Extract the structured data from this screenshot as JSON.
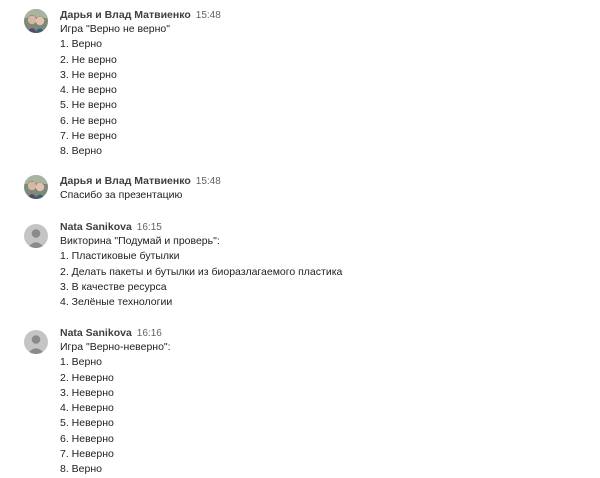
{
  "messages": [
    {
      "sender": "Дарья и Влад Матвиенко",
      "time": "15:48",
      "avatar": "photo-avatar-icon",
      "lines": [
        "Игра \"Верно не верно\"",
        "1. Верно",
        "2. Не верно",
        "3. Не верно",
        "4. Не верно",
        "5. Не верно",
        "6. Не верно",
        "7. Не верно",
        "8. Верно"
      ]
    },
    {
      "sender": "Дарья и Влад Матвиенко",
      "time": "15:48",
      "avatar": "photo-avatar-icon",
      "lines": [
        "Спасибо за презентацию"
      ]
    },
    {
      "sender": "Nata Sanikova",
      "time": "16:15",
      "avatar": "default-user-avatar-icon",
      "lines": [
        "Викторина \"Подумай и проверь\":",
        "1. Пластиковые бутылки",
        "2. Делать пакеты и бутылки из биоразлагаемого пластика",
        "3. В качестве ресурса",
        "4. Зелёные технологии"
      ]
    },
    {
      "sender": "Nata Sanikova",
      "time": "16:16",
      "avatar": "default-user-avatar-icon",
      "lines": [
        "Игра \"Верно-неверно\":",
        "1. Верно",
        "2. Неверно",
        "3. Неверно",
        "4. Неверно",
        "5. Неверно",
        "6. Неверно",
        "7. Неверно",
        "8. Верно"
      ]
    }
  ],
  "colors": {
    "sender": "#3c4043",
    "time": "#5f6368",
    "text": "#202124",
    "default_avatar_bg": "#c4c4c4",
    "default_avatar_fg": "#8a8a8a"
  }
}
